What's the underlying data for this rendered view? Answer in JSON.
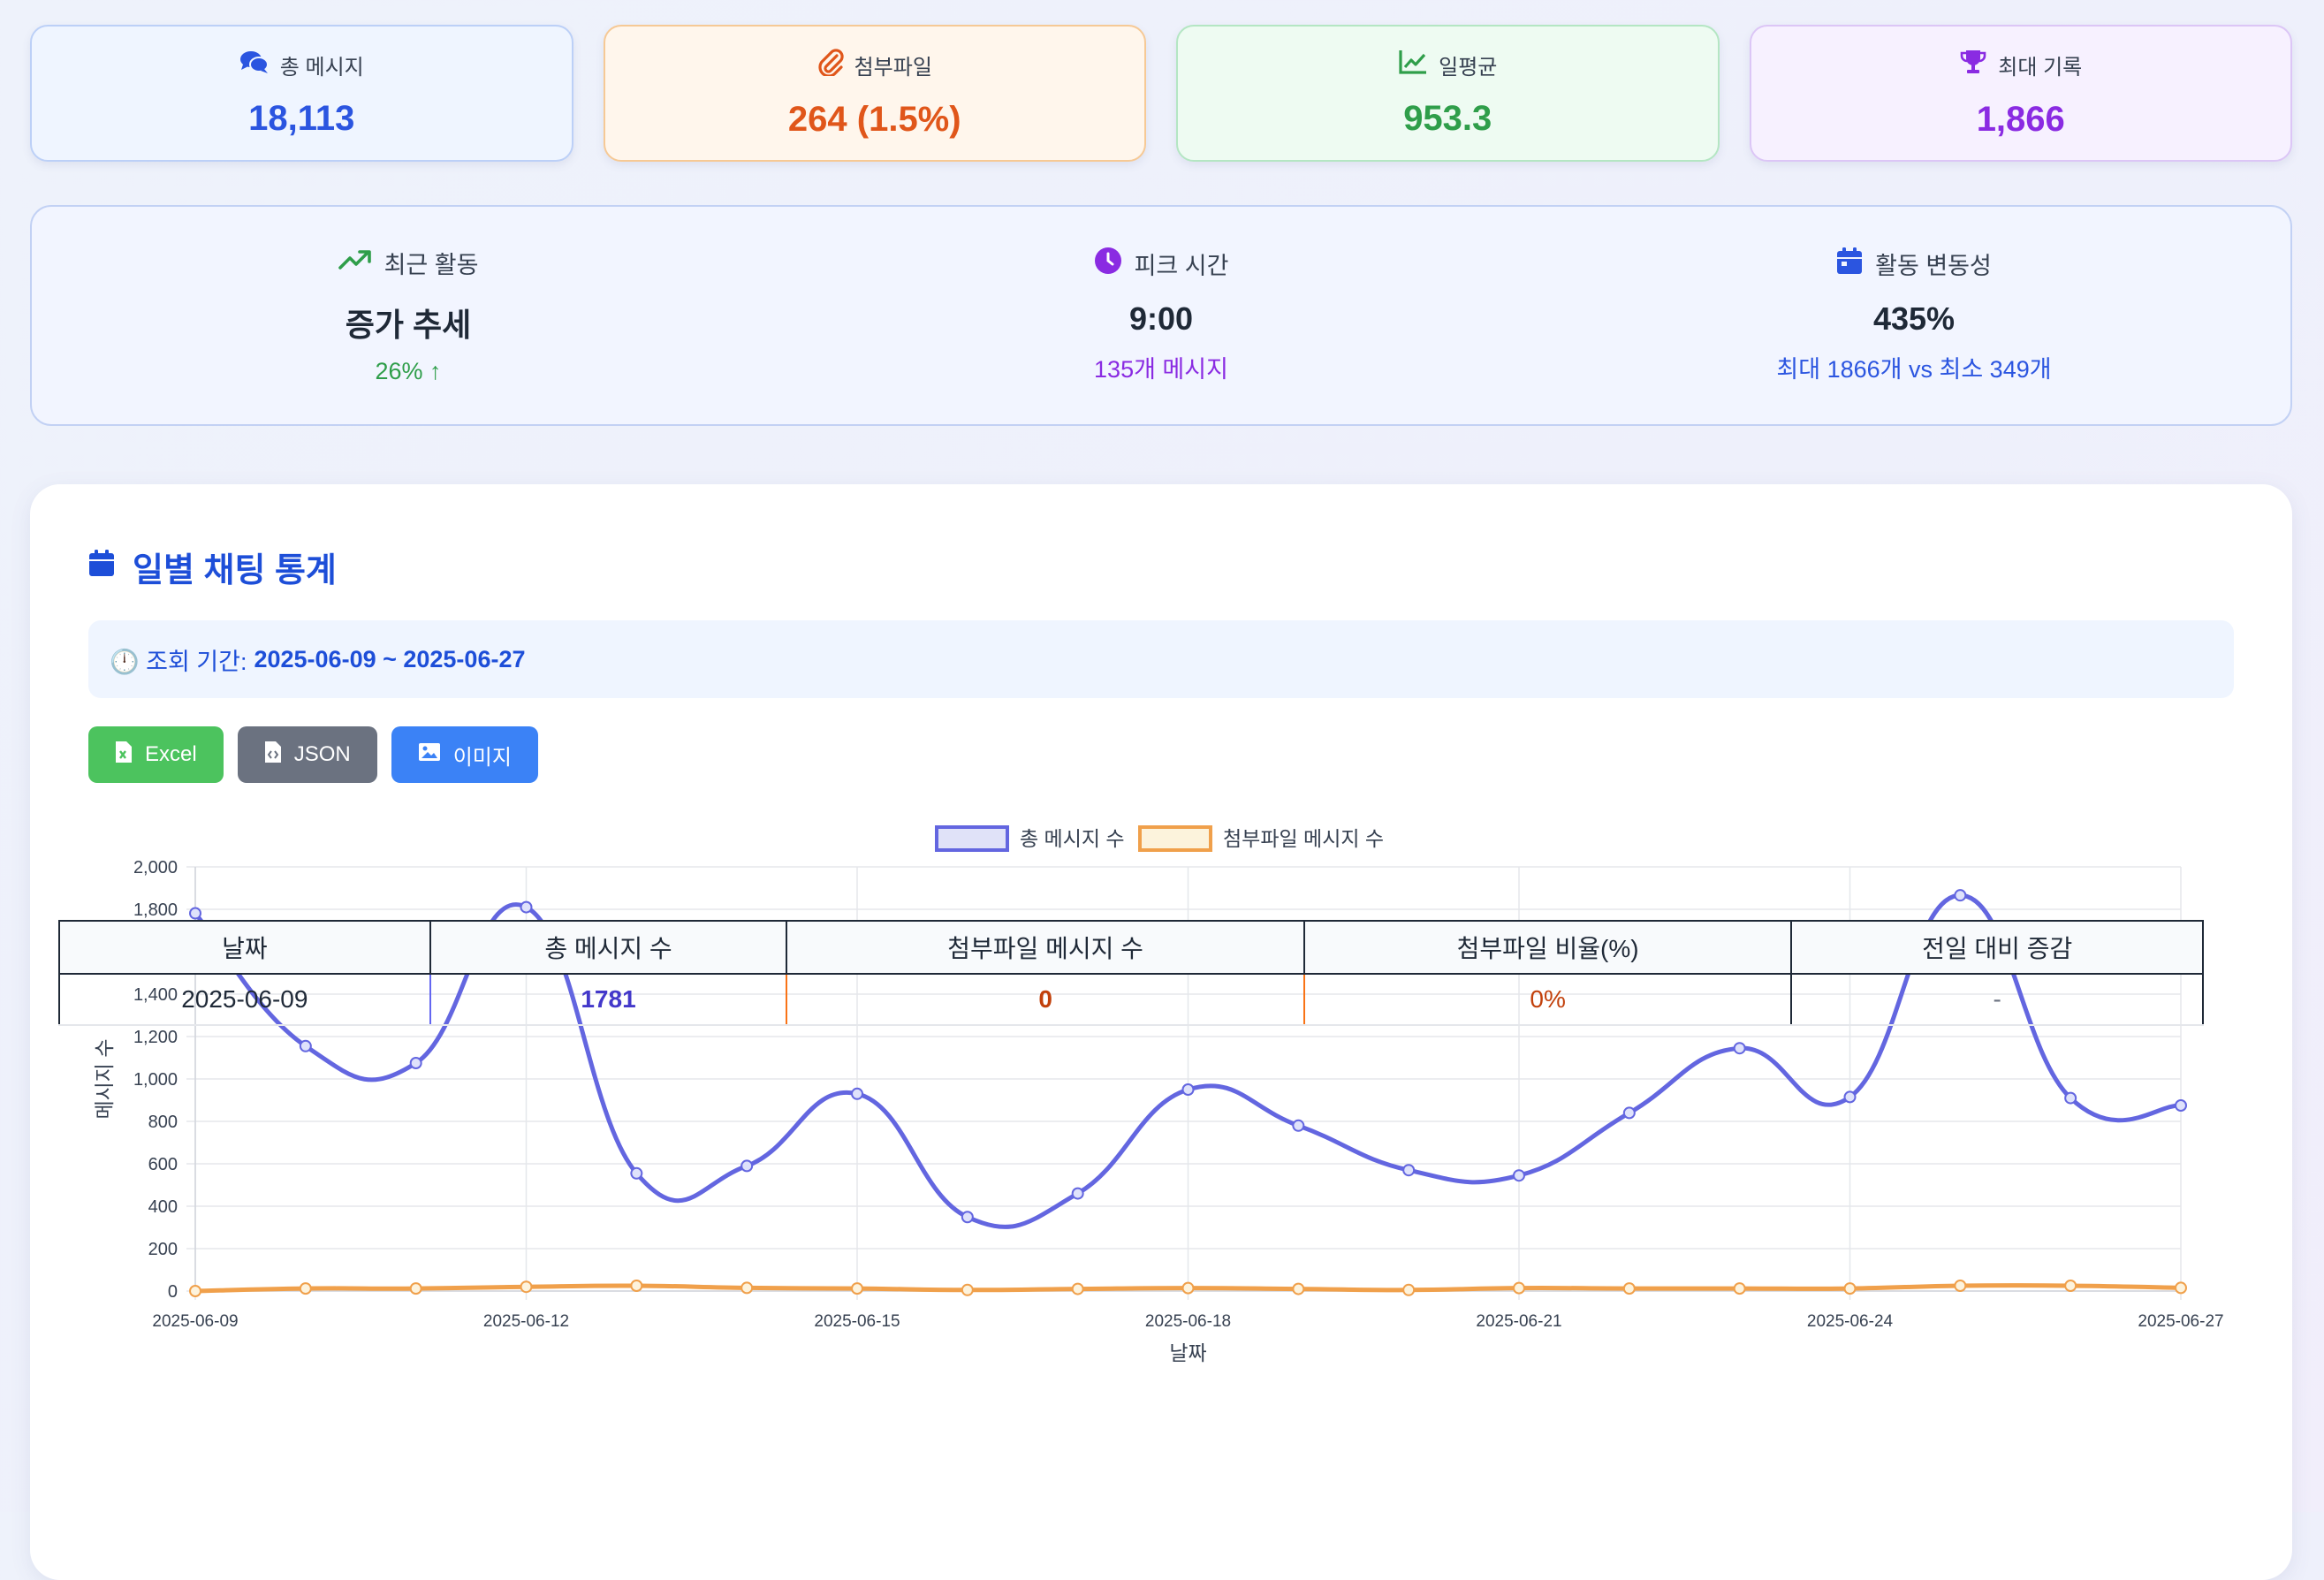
{
  "stats": [
    {
      "label": "총 메시지",
      "value": "18,113",
      "icon": "comments-icon",
      "color": "#2b55e0"
    },
    {
      "label": "첨부파일",
      "value": "264 (1.5%)",
      "icon": "paperclip-icon",
      "color": "#e0561a"
    },
    {
      "label": "일평균",
      "value": "953.3",
      "icon": "line-chart-icon",
      "color": "#2f9e4a"
    },
    {
      "label": "최대 기록",
      "value": "1,866",
      "icon": "trophy-icon",
      "color": "#8a2be2"
    }
  ],
  "insights": [
    {
      "label": "최근 활동",
      "value": "증가 추세",
      "sub": "26% ↑",
      "sub_color": "#2f9e4a",
      "icon": "trending-up-icon"
    },
    {
      "label": "피크 시간",
      "value": "9:00",
      "sub": "135개 메시지",
      "sub_color": "#8a2be2",
      "icon": "clock-icon"
    },
    {
      "label": "활동 변동성",
      "value": "435%",
      "sub": "최대 1866개 vs 최소 349개",
      "sub_color": "#2b55e0",
      "icon": "calendar-icon"
    }
  ],
  "section": {
    "title": "일별 채팅 통계",
    "period_label": "🕛 조회 기간:",
    "period_range": "2025-06-09 ~ 2025-06-27"
  },
  "buttons": {
    "excel": "Excel",
    "json": "JSON",
    "image": "이미지"
  },
  "chart_data": {
    "type": "line",
    "x": [
      "2025-06-09",
      "2025-06-10",
      "2025-06-11",
      "2025-06-12",
      "2025-06-13",
      "2025-06-14",
      "2025-06-15",
      "2025-06-16",
      "2025-06-17",
      "2025-06-18",
      "2025-06-19",
      "2025-06-20",
      "2025-06-21",
      "2025-06-22",
      "2025-06-23",
      "2025-06-24",
      "2025-06-25",
      "2025-06-26",
      "2025-06-27"
    ],
    "x_tick_labels": [
      "2025-06-09",
      "2025-06-12",
      "2025-06-15",
      "2025-06-18",
      "2025-06-21",
      "2025-06-24",
      "2025-06-27"
    ],
    "series": [
      {
        "name": "총 메시지 수",
        "color": "#6366e0",
        "values": [
          1781,
          1155,
          1075,
          1810,
          555,
          590,
          930,
          349,
          460,
          950,
          780,
          570,
          545,
          840,
          1145,
          915,
          1866,
          910,
          875
        ]
      },
      {
        "name": "첨부파일 메시지 수",
        "color": "#f0a04b",
        "values": [
          0,
          12,
          12,
          20,
          25,
          15,
          12,
          5,
          10,
          14,
          10,
          5,
          14,
          12,
          12,
          12,
          25,
          25,
          15
        ]
      }
    ],
    "xlabel": "날짜",
    "ylabel": "메시지 수",
    "ylim": [
      0,
      2000
    ],
    "y_ticks": [
      "0",
      "200",
      "400",
      "600",
      "800",
      "1,000",
      "1,200",
      "1,400",
      "1,600",
      "1,800",
      "2,000"
    ],
    "grid": true,
    "legend": "top-center"
  },
  "table": {
    "headers": [
      "날짜",
      "총 메시지 수",
      "첨부파일 메시지 수",
      "첨부파일 비율(%)",
      "전일 대비 증감"
    ],
    "rows": [
      [
        "2025-06-09",
        "1781",
        "0",
        "0%",
        "-"
      ]
    ]
  }
}
